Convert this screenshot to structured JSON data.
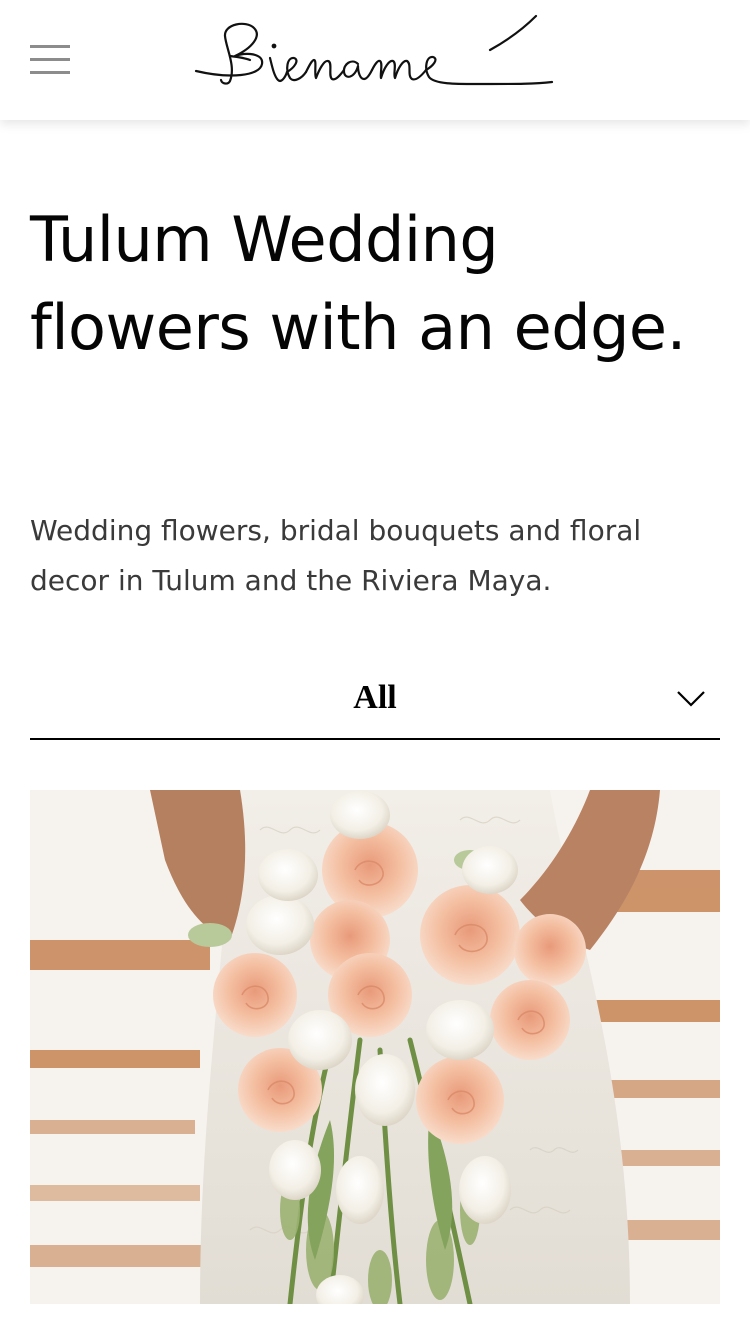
{
  "header": {
    "logo_text": "Biename",
    "menu_icon": "hamburger-menu-icon"
  },
  "hero": {
    "title": "Tulum Wedding flowers with an edge.",
    "subtitle": "Wedding flowers, bridal bouquets and floral decor in Tulum and the Riviera Maya."
  },
  "filter": {
    "selected": "All",
    "icon": "chevron-down-icon"
  },
  "gallery": {
    "image_subject": "bridal bouquet of peach roses and white tulips",
    "colors": {
      "wood": "#c8875a",
      "dress": "#ece8e1",
      "rose": "#f0b99a",
      "tulip": "#f7f4ee",
      "stem": "#7e9a57",
      "skin": "#b98262"
    }
  }
}
